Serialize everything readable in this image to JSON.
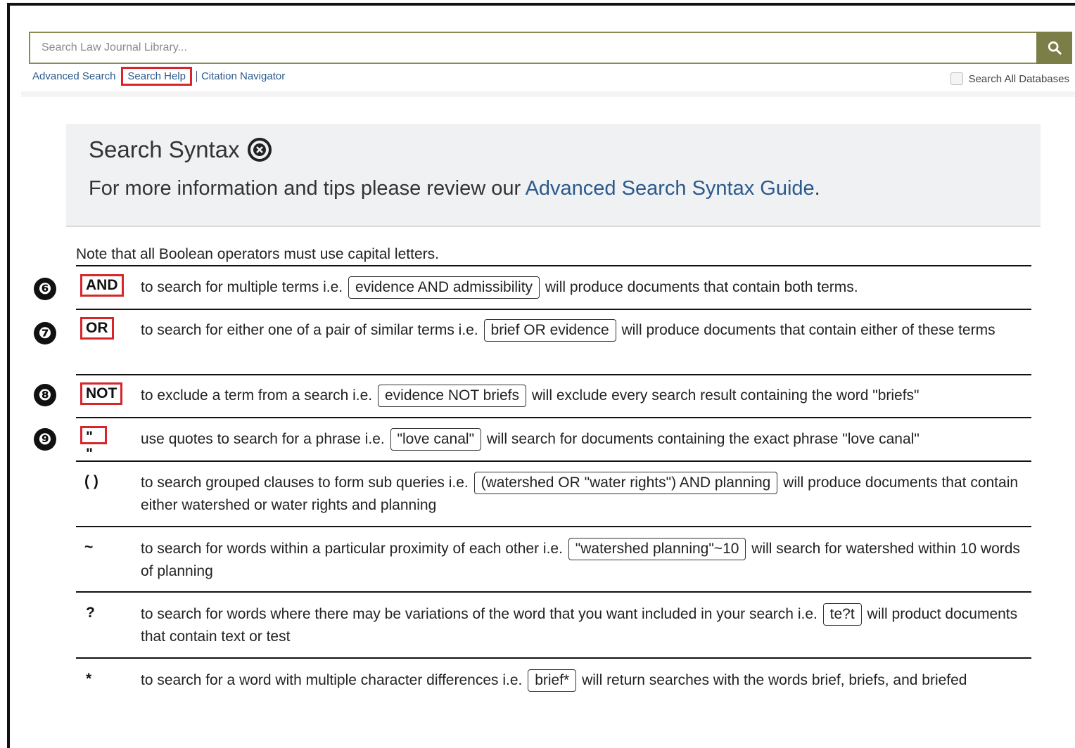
{
  "search": {
    "placeholder": "Search Law Journal Library...",
    "search_all_label": "Search All Databases"
  },
  "links": {
    "advanced": "Advanced Search",
    "help": "Search Help",
    "citation": "Citation Navigator"
  },
  "panel": {
    "title": "Search Syntax",
    "sub_prefix": "For more information and tips please review our ",
    "sub_link": "Advanced Search Syntax Guide",
    "sub_suffix": "."
  },
  "note": "Note that all Boolean operators must use capital letters.",
  "markers": [
    "❻",
    "❼",
    "❽",
    "❾"
  ],
  "rows": [
    {
      "op": "AND",
      "pre": "to search for multiple terms i.e. ",
      "example": "evidence AND admissibility",
      "post": " will produce documents that contain both terms."
    },
    {
      "op": "OR",
      "pre": "to search for either one of a pair of similar terms i.e. ",
      "example": "brief OR evidence",
      "post": " will produce documents that contain either of these terms"
    },
    {
      "op": "NOT",
      "pre": "to exclude a term from a search i.e. ",
      "example": "evidence NOT briefs",
      "post": " will exclude every search result containing the word \"briefs\""
    },
    {
      "op": "\" \"",
      "pre": "use quotes to search for a phrase i.e. ",
      "example": "\"love canal\"",
      "post": " will search for documents containing the exact phrase \"love canal\""
    },
    {
      "op": "( )",
      "pre": "to search grouped clauses to form sub queries i.e. ",
      "example": "(watershed OR \"water rights\") AND planning",
      "post": " will produce documents that contain either watershed or water rights and planning"
    },
    {
      "op": "~",
      "pre": "to search for words within a particular proximity of each other i.e. ",
      "example": "\"watershed planning\"~10",
      "post": " will search for watershed within 10 words of planning"
    },
    {
      "op": "?",
      "pre": "to search for words where there may be variations of the word that you want included in your search i.e. ",
      "example": "te?t",
      "post": " will product documents that contain text or test"
    },
    {
      "op": "*",
      "pre": "to search for a word with multiple character differences i.e. ",
      "example": "brief*",
      "post": " will return searches with the words brief, briefs, and briefed"
    }
  ]
}
